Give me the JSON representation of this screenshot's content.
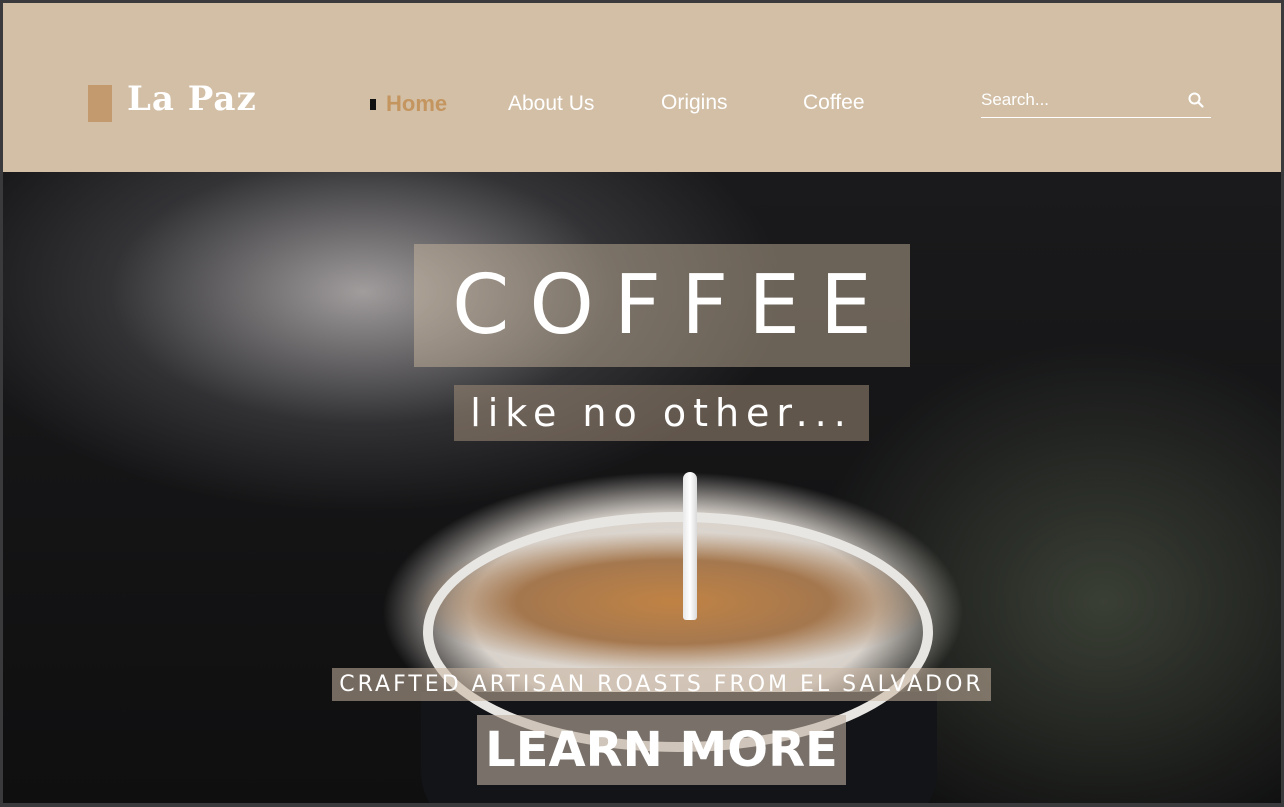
{
  "brand": {
    "name": "La Paz"
  },
  "nav": {
    "items": [
      {
        "label": "Home",
        "active": true
      },
      {
        "label": "About Us",
        "active": false
      },
      {
        "label": "Origins",
        "active": false
      },
      {
        "label": "Coffee",
        "active": false
      }
    ]
  },
  "search": {
    "placeholder": "Search...",
    "value": "",
    "icon": "search-icon"
  },
  "hero": {
    "title": "COFFEE",
    "subtitle": "like no other...",
    "tagline": "CRAFTED ARTISAN ROASTS FROM EL SALVADOR",
    "cta_label": "LEARN MORE"
  },
  "colors": {
    "header_bg": "#d2bfa6",
    "accent": "#c4955f",
    "logo_mark": "#c39a6d"
  }
}
